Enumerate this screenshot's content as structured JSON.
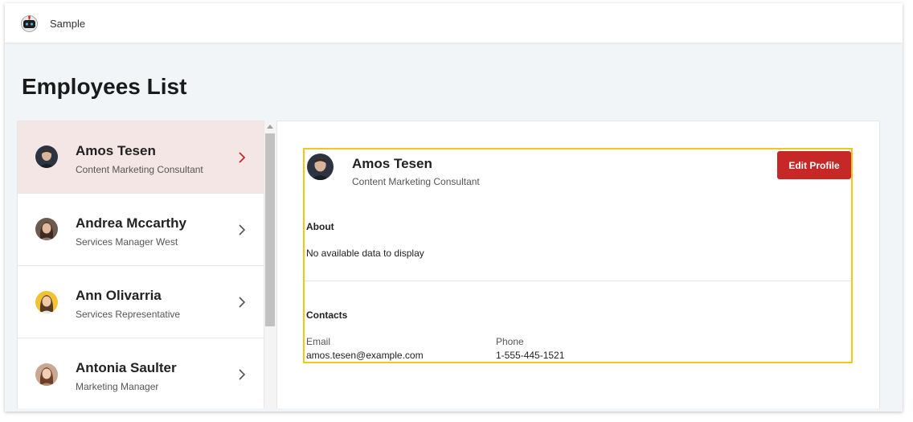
{
  "app": {
    "title": "Sample",
    "logo_icon": "robot-logo-icon"
  },
  "page": {
    "title": "Employees List"
  },
  "employees": [
    {
      "name": "Amos Tesen",
      "role": "Content Marketing Consultant",
      "selected": true
    },
    {
      "name": "Andrea Mccarthy",
      "role": "Services Manager West",
      "selected": false
    },
    {
      "name": "Ann Olivarria",
      "role": "Services Representative",
      "selected": false
    },
    {
      "name": "Antonia Saulter",
      "role": "Marketing Manager",
      "selected": false
    }
  ],
  "detail": {
    "name": "Amos Tesen",
    "role": "Content Marketing Consultant",
    "edit_button_label": "Edit Profile",
    "about_title": "About",
    "about_text": "No available data to display",
    "contacts_title": "Contacts",
    "email_label": "Email",
    "email_value": "amos.tesen@example.com",
    "phone_label": "Phone",
    "phone_value": "1-555-445-1521"
  },
  "colors": {
    "accent": "#c62828",
    "selected_row": "#f5e6e6",
    "highlight_border": "#f5c518",
    "chevron_active": "#c62828",
    "chevron_default": "#555555"
  }
}
